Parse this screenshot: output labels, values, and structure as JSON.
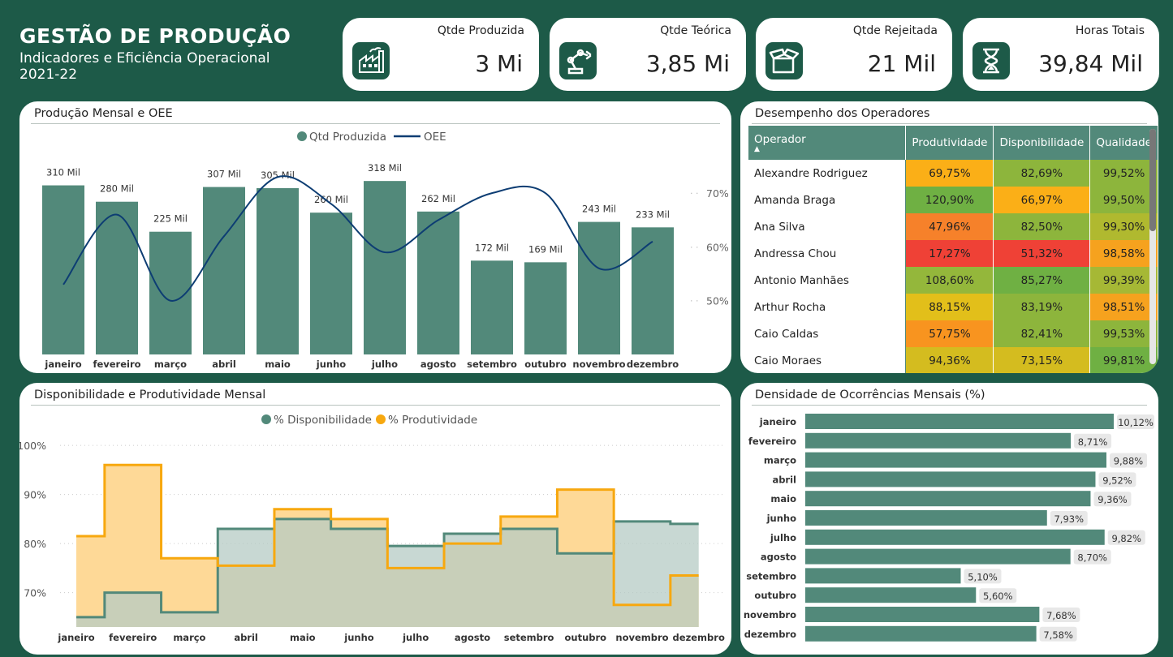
{
  "header": {
    "title": "GESTÃO DE PRODUÇÃO",
    "subtitle_line1": "Indicadores e Eficiência Operacional",
    "subtitle_line2": "2021-22"
  },
  "kpis": [
    {
      "label": "Qtde Produzida",
      "value": "3 Mi",
      "icon": "factory-icon"
    },
    {
      "label": "Qtde Teórica",
      "value": "3,85 Mi",
      "icon": "robot-arm-icon"
    },
    {
      "label": "Qtde Rejeitada",
      "value": "21 Mil",
      "icon": "open-box-icon"
    },
    {
      "label": "Horas Totais",
      "value": "39,84 Mil",
      "icon": "hourglass-icon"
    }
  ],
  "colors": {
    "background": "#1d5a48",
    "bar": "#52897a",
    "oee_line": "#0d3d73",
    "productivity": "#f7a80f",
    "productivity_fill": "#fed997",
    "availability_fill": "#b5cbc4"
  },
  "months": [
    "janeiro",
    "fevereiro",
    "março",
    "abril",
    "maio",
    "junho",
    "julho",
    "agosto",
    "setembro",
    "outubro",
    "novembro",
    "dezembro"
  ],
  "chart_data": [
    {
      "type": "bar",
      "title": "Produção Mensal e OEE",
      "legend": [
        "Qtd Produzida",
        "OEE"
      ],
      "legend_position": "top-center",
      "categories": [
        "janeiro",
        "fevereiro",
        "março",
        "abril",
        "maio",
        "junho",
        "julho",
        "agosto",
        "setembro",
        "outubro",
        "novembro",
        "dezembro"
      ],
      "series": [
        {
          "name": "Qtd Produzida",
          "values": [
            310,
            280,
            225,
            307,
            305,
            260,
            318,
            262,
            172,
            169,
            243,
            233
          ],
          "labels": [
            "310 Mil",
            "280 Mil",
            "225 Mil",
            "307 Mil",
            "305 Mil",
            "260 Mil",
            "318 Mil",
            "262 Mil",
            "172 Mil",
            "169 Mil",
            "243 Mil",
            "233 Mil"
          ]
        },
        {
          "name": "OEE",
          "values": [
            53,
            66,
            50,
            62,
            73,
            68,
            59,
            65,
            70,
            70,
            56,
            61
          ],
          "axis": "right"
        }
      ],
      "y2_ticks": [
        "50%",
        "60%",
        "70%"
      ],
      "y2_range": [
        40,
        75
      ],
      "ylim": [
        0,
        345
      ]
    },
    {
      "type": "area",
      "title": "Disponibilidade e Produtividade Mensal",
      "legend": [
        "% Disponibilidade",
        "% Produtividade"
      ],
      "legend_position": "top-center",
      "step": true,
      "categories": [
        "janeiro",
        "fevereiro",
        "março",
        "abril",
        "maio",
        "junho",
        "julho",
        "agosto",
        "setembro",
        "outubro",
        "novembro",
        "dezembro"
      ],
      "series": [
        {
          "name": "% Disponibilidade",
          "values": [
            65,
            70,
            66,
            83,
            85,
            83,
            79.5,
            82,
            83,
            78,
            84.5,
            84
          ]
        },
        {
          "name": "% Produtividade",
          "values": [
            81.5,
            96,
            77,
            75.5,
            87,
            85,
            75,
            80,
            85.5,
            91,
            67.5,
            73.5
          ]
        }
      ],
      "y_ticks": [
        "70%",
        "80%",
        "90%",
        "100%"
      ],
      "ylim": [
        63,
        102
      ],
      "grid": true
    },
    {
      "type": "bar",
      "orientation": "horizontal",
      "title": "Densidade de Ocorrências Mensais (%)",
      "categories": [
        "janeiro",
        "fevereiro",
        "março",
        "abril",
        "maio",
        "junho",
        "julho",
        "agosto",
        "setembro",
        "outubro",
        "novembro",
        "dezembro"
      ],
      "values": [
        10.12,
        8.71,
        9.88,
        9.52,
        9.36,
        7.93,
        9.82,
        8.7,
        5.1,
        5.6,
        7.68,
        7.58
      ],
      "labels": [
        "10,12%",
        "8,71%",
        "9,88%",
        "9,52%",
        "9,36%",
        "7,93%",
        "9,82%",
        "8,70%",
        "5,10%",
        "5,60%",
        "7,68%",
        "7,58%"
      ],
      "xlim": [
        0,
        10.12
      ]
    }
  ],
  "operators": {
    "title": "Desempenho dos Operadores",
    "columns": [
      "Operador",
      "Produtividade",
      "Disponibilidade",
      "Qualidade"
    ],
    "rows": [
      {
        "name": "Alexandre Rodriguez",
        "prod": "69,75%",
        "disp": "82,69%",
        "qual": "99,52%",
        "colors": [
          "#fbaf17",
          "#8db53c",
          "#8db53c"
        ]
      },
      {
        "name": "Amanda Braga",
        "prod": "120,90%",
        "disp": "66,97%",
        "qual": "99,50%",
        "colors": [
          "#6fb043",
          "#fbaf17",
          "#8db53c"
        ]
      },
      {
        "name": "Ana Silva",
        "prod": "47,96%",
        "disp": "82,50%",
        "qual": "99,30%",
        "colors": [
          "#f6812a",
          "#8db53c",
          "#b0b92f"
        ]
      },
      {
        "name": "Andressa Chou",
        "prod": "17,27%",
        "disp": "51,32%",
        "qual": "98,58%",
        "colors": [
          "#ef4136",
          "#ef4136",
          "#f6a21e"
        ]
      },
      {
        "name": "Antonio Manhães",
        "prod": "108,60%",
        "disp": "85,27%",
        "qual": "99,39%",
        "colors": [
          "#94b73b",
          "#6fb043",
          "#a6b835"
        ]
      },
      {
        "name": "Arthur Rocha",
        "prod": "88,15%",
        "disp": "83,19%",
        "qual": "98,51%",
        "colors": [
          "#e2bf1a",
          "#8db53c",
          "#f6a21e"
        ]
      },
      {
        "name": "Caio Caldas",
        "prod": "57,75%",
        "disp": "82,41%",
        "qual": "99,53%",
        "colors": [
          "#f8941f",
          "#8db53c",
          "#8db53c"
        ]
      },
      {
        "name": "Caio Moraes",
        "prod": "94,36%",
        "disp": "73,15%",
        "qual": "99,81%",
        "colors": [
          "#d4bc1f",
          "#d4bc1f",
          "#6fb043"
        ]
      }
    ]
  }
}
